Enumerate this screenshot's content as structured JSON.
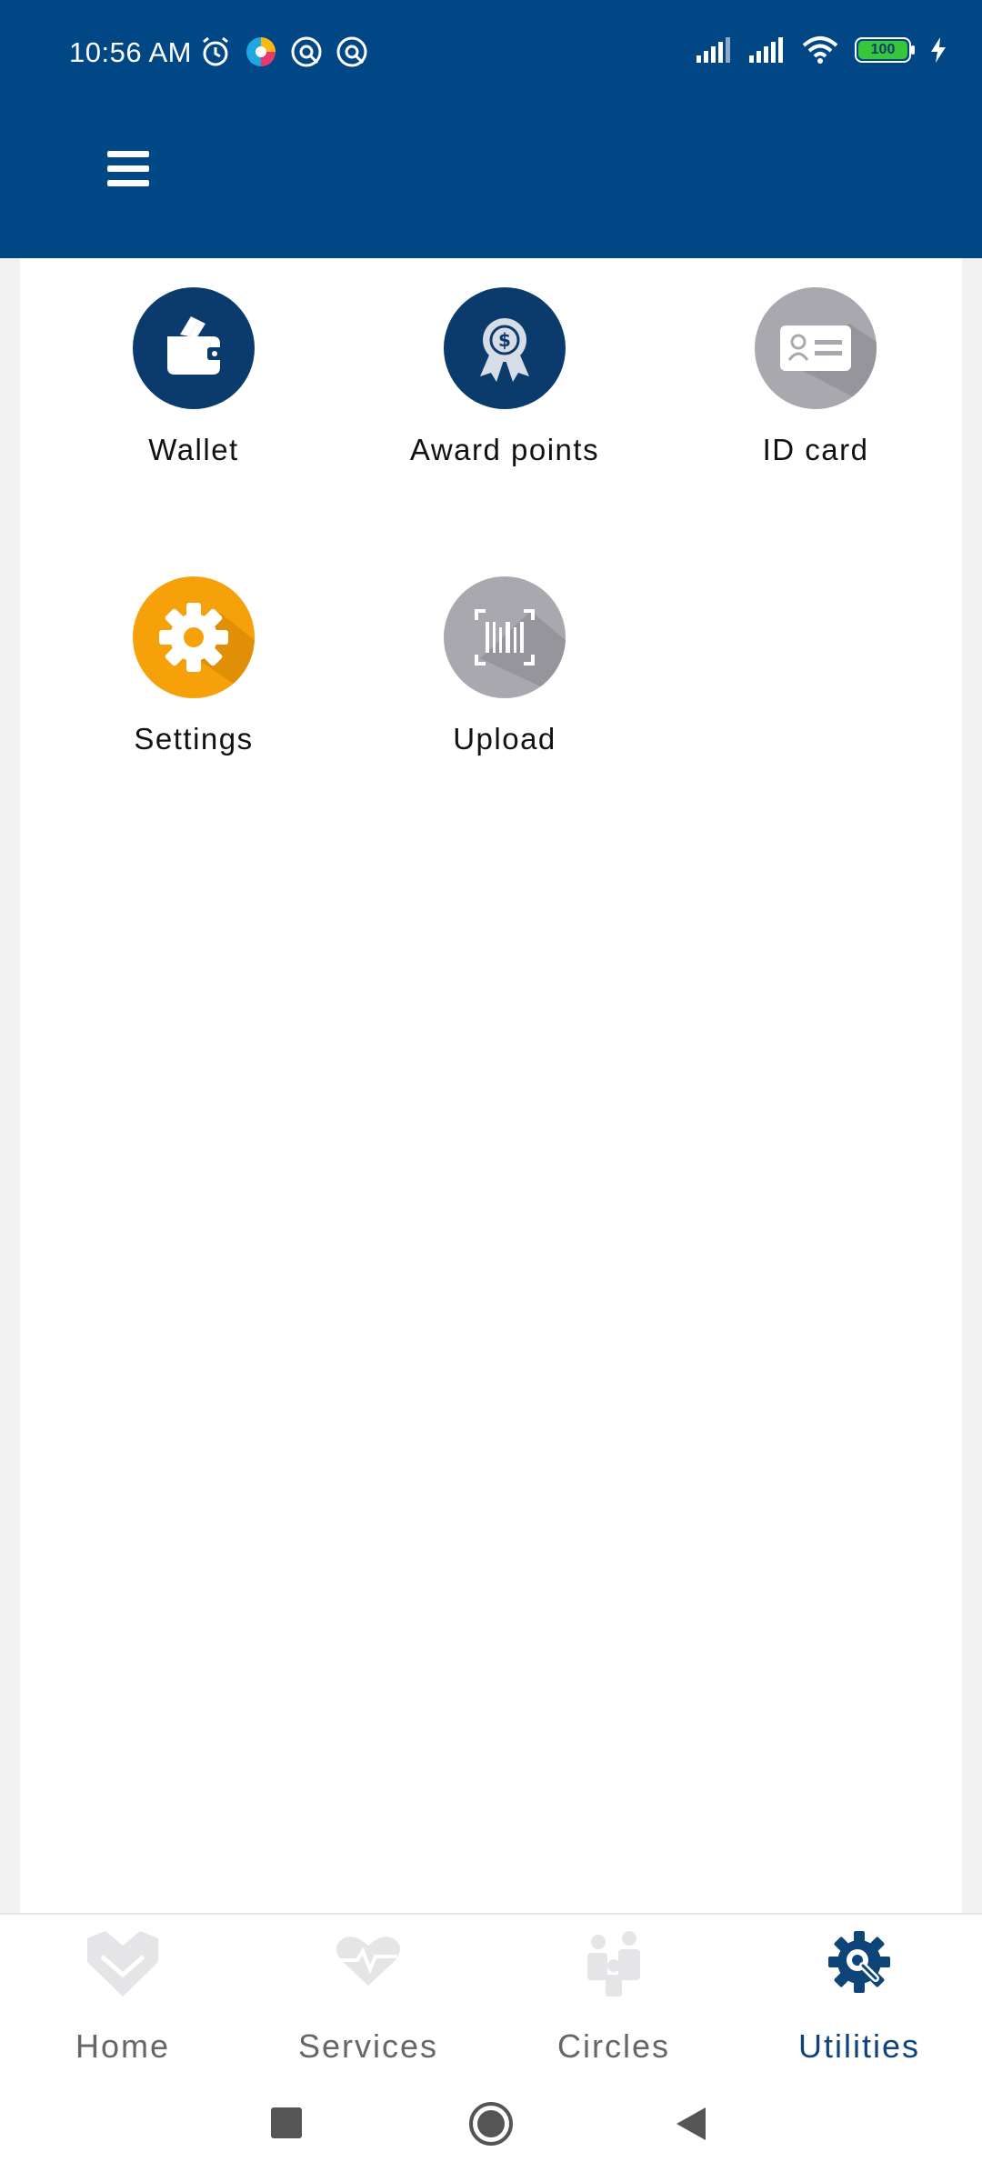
{
  "status_bar": {
    "time": "10:56 AM",
    "battery": "100",
    "icons_left": [
      "alarm-icon",
      "browser-icon",
      "notification-icon",
      "notification-icon"
    ],
    "icons_right": [
      "signal-icon",
      "signal-icon",
      "wifi-icon",
      "battery-icon",
      "charging-icon"
    ]
  },
  "header": {
    "menu_icon": "hamburger-menu-icon",
    "background": "#014785"
  },
  "utilities": [
    {
      "label": "Wallet",
      "icon": "wallet-icon",
      "color": "#0b3a6c"
    },
    {
      "label": "Award points",
      "icon": "award-icon",
      "color": "#0b3a6c"
    },
    {
      "label": "ID card",
      "icon": "id-card-icon",
      "color": "#a9a8ae"
    },
    {
      "label": "Settings",
      "icon": "gear-icon",
      "color": "#f6a10a"
    },
    {
      "label": "Upload",
      "icon": "barcode-scan-icon",
      "color": "#a9a8ae"
    }
  ],
  "bottom_nav": {
    "items": [
      {
        "label": "Home",
        "icon": "home-icon",
        "active": false
      },
      {
        "label": "Services",
        "icon": "heartbeat-icon",
        "active": false
      },
      {
        "label": "Circles",
        "icon": "people-icon",
        "active": false
      },
      {
        "label": "Utilities",
        "icon": "wrench-gear-icon",
        "active": true
      }
    ],
    "active_color": "#0f4478",
    "inactive_color": "#666666"
  },
  "system_nav": [
    "recents-button",
    "home-button",
    "back-button"
  ]
}
